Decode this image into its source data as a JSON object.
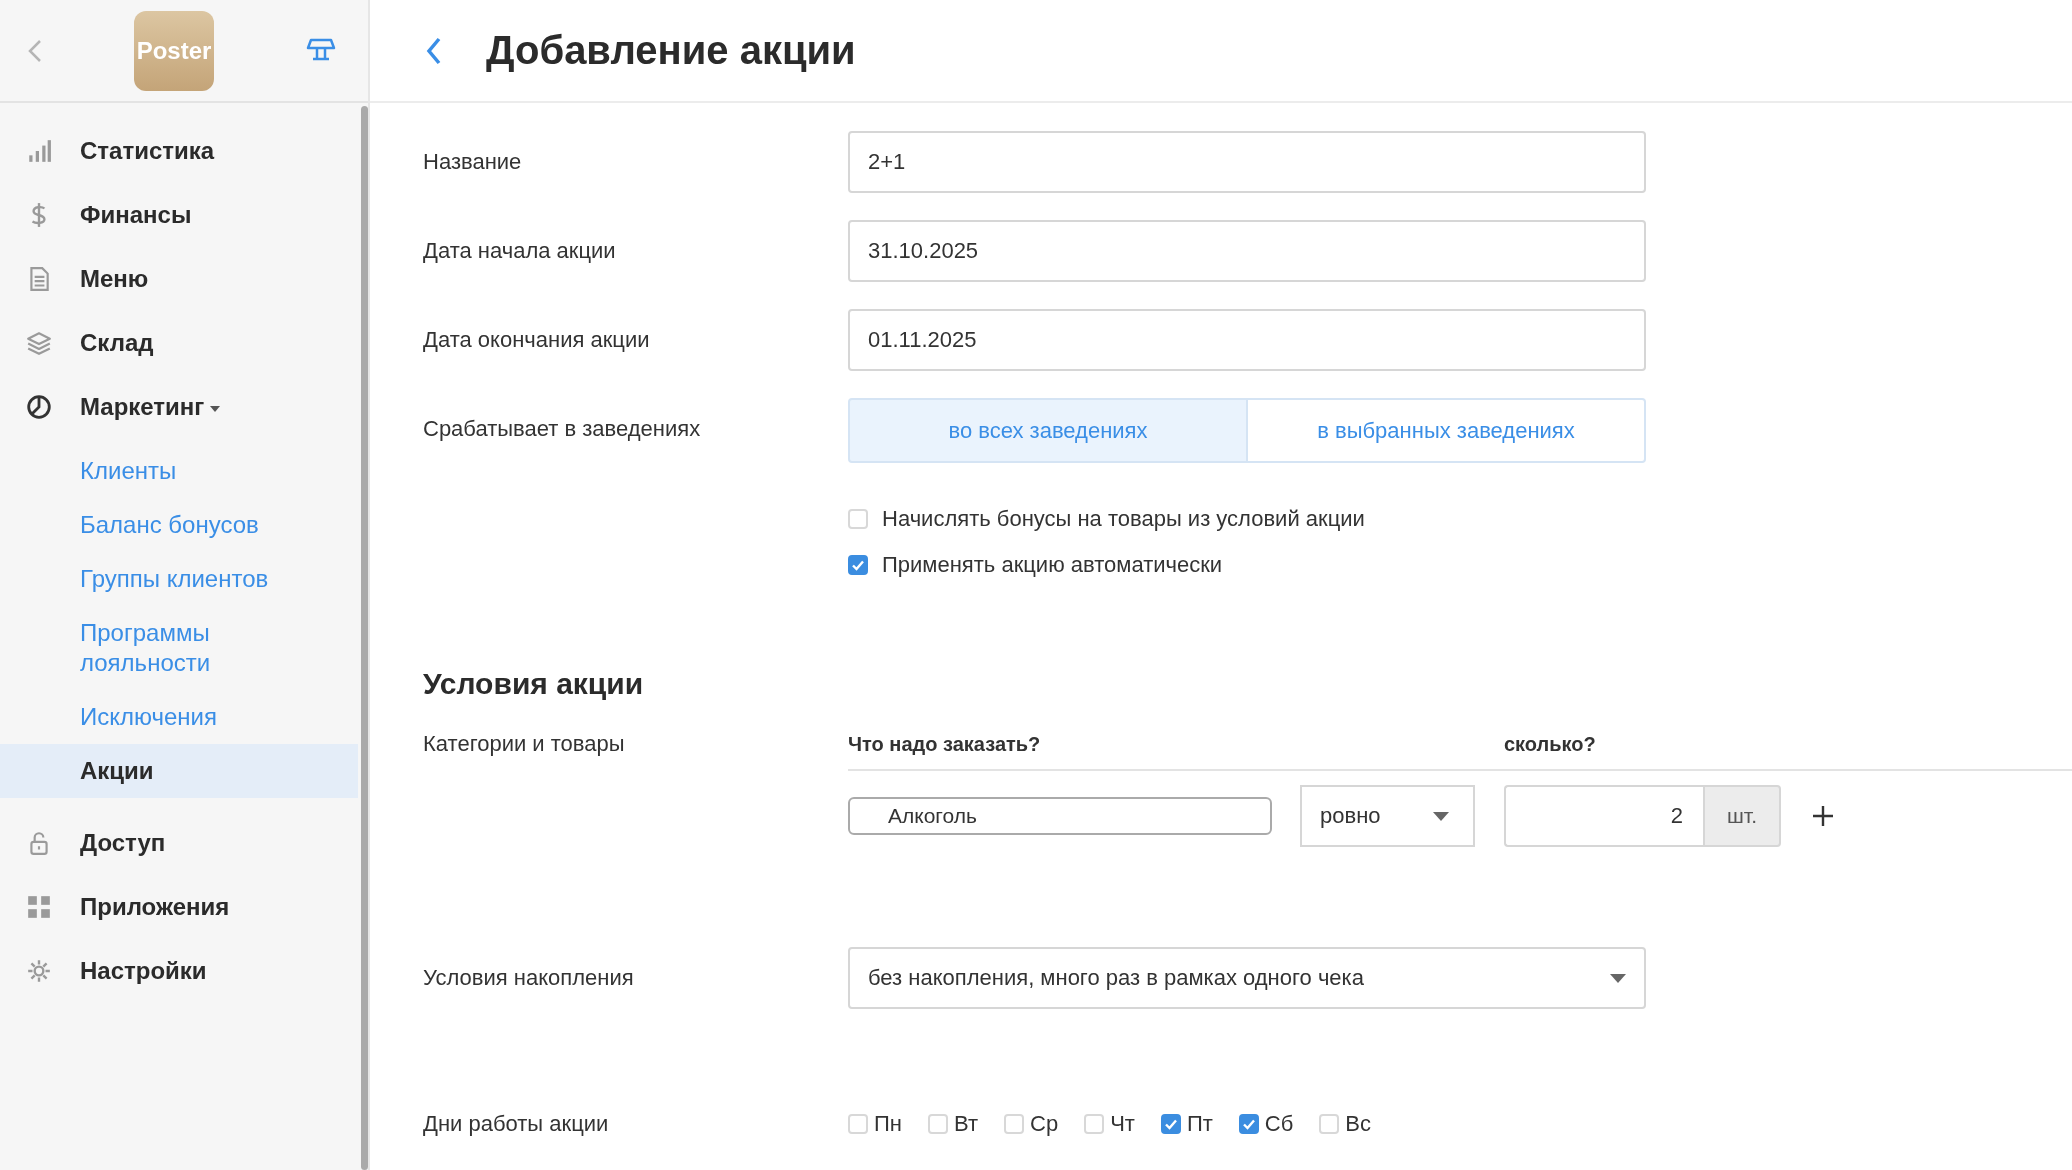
{
  "sidebar": {
    "logo": "Poster",
    "items": [
      {
        "label": "Статистика",
        "kind": "chart",
        "selected": false
      },
      {
        "label": "Финансы",
        "kind": "dollar",
        "selected": false
      },
      {
        "label": "Меню",
        "kind": "document",
        "selected": false
      },
      {
        "label": "Склад",
        "kind": "layers",
        "selected": false
      },
      {
        "label": "Маркетинг",
        "kind": "pie",
        "selected": false,
        "expanded": true,
        "children": [
          {
            "label": "Клиенты",
            "selected": false
          },
          {
            "label": "Баланс бонусов",
            "selected": false
          },
          {
            "label": "Группы клиентов",
            "selected": false
          },
          {
            "label": "Программы лояльности",
            "selected": false
          },
          {
            "label": "Исключения",
            "selected": false
          },
          {
            "label": "Акции",
            "selected": true
          }
        ]
      },
      {
        "label": "Доступ",
        "kind": "lock",
        "selected": false
      },
      {
        "label": "Приложения",
        "kind": "grid",
        "selected": false
      },
      {
        "label": "Настройки",
        "kind": "gear",
        "selected": false
      }
    ]
  },
  "header": {
    "title": "Добавление акции"
  },
  "form": {
    "fields": [
      {
        "label": "Название",
        "value": "2+1"
      },
      {
        "label": "Дата начала акции",
        "value": "31.10.2025"
      },
      {
        "label": "Дата окончания акции",
        "value": "01.11.2025"
      }
    ],
    "venues": {
      "label": "Срабатывает в заведениях",
      "options": [
        {
          "label": "во всех заведениях",
          "selected": true
        },
        {
          "label": "в выбранных заведениях",
          "selected": false
        }
      ]
    },
    "checkboxes": [
      {
        "label": "Начислять бонусы на товары из условий акции",
        "checked": false
      },
      {
        "label": "Применять акцию автоматически",
        "checked": true
      }
    ],
    "section_title": "Условия акции",
    "products": {
      "label": "Категории и товары",
      "columns": [
        "Что надо заказать?",
        "сколько?"
      ],
      "rows": [
        {
          "product": "Алкоголь",
          "mode": "ровно",
          "quantity": "2",
          "unit": "шт."
        }
      ]
    },
    "accumulation": {
      "label": "Условия накопления",
      "value": "без накопления, много раз в рамках одного чека"
    },
    "days": {
      "label": "Дни работы акции",
      "items": [
        {
          "label": "Пн",
          "checked": false
        },
        {
          "label": "Вт",
          "checked": false
        },
        {
          "label": "Ср",
          "checked": false
        },
        {
          "label": "Чт",
          "checked": false
        },
        {
          "label": "Пт",
          "checked": true
        },
        {
          "label": "Сб",
          "checked": true
        },
        {
          "label": "Вс",
          "checked": false
        }
      ]
    }
  }
}
